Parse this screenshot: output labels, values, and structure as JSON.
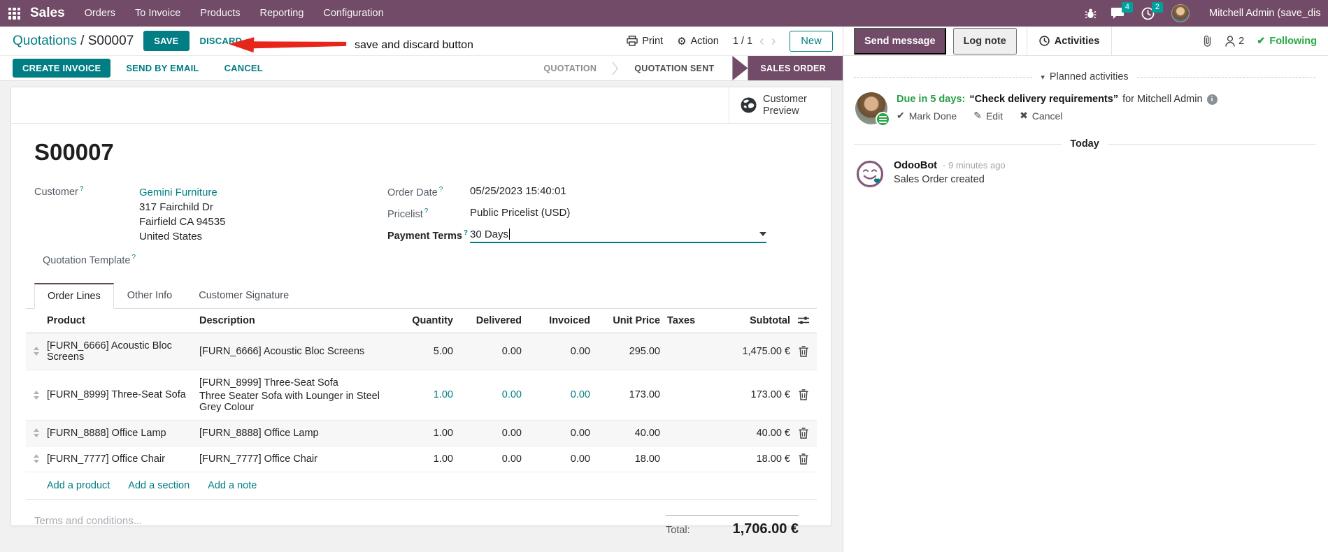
{
  "topbar": {
    "app_name": "Sales",
    "menus": [
      "Orders",
      "To Invoice",
      "Products",
      "Reporting",
      "Configuration"
    ],
    "message_badge": "4",
    "activity_badge": "2",
    "user_name": "Mitchell Admin (save_discar"
  },
  "control_panel": {
    "breadcrumb_parent": "Quotations",
    "breadcrumb_sep": " / ",
    "breadcrumb_current": "S00007",
    "save_label": "SAVE",
    "discard_label": "DISCARD",
    "annotation": "save and discard button",
    "print_label": "Print",
    "action_label": "Action",
    "pager": "1 / 1",
    "new_label": "New"
  },
  "statusbar": {
    "buttons": [
      "CREATE INVOICE",
      "SEND BY EMAIL",
      "CANCEL"
    ],
    "states": [
      "QUOTATION",
      "QUOTATION SENT",
      "SALES ORDER"
    ],
    "active_state": "SALES ORDER"
  },
  "sheet": {
    "customer_preview": {
      "line1": "Customer",
      "line2": "Preview"
    },
    "order_ref": "S00007",
    "fields": {
      "customer_label": "Customer",
      "customer_name": "Gemini Furniture",
      "address_line1": "317 Fairchild Dr",
      "address_line2": "Fairfield CA 94535",
      "address_line3": "United States",
      "quotation_template_label": "Quotation Template",
      "order_date_label": "Order Date",
      "order_date_value": "05/25/2023 15:40:01",
      "pricelist_label": "Pricelist",
      "pricelist_value": "Public Pricelist (USD)",
      "payment_terms_label": "Payment Terms",
      "payment_terms_value": "30 Days"
    },
    "tabs": [
      "Order Lines",
      "Other Info",
      "Customer Signature"
    ],
    "active_tab": "Order Lines",
    "order_lines": {
      "columns": [
        "Product",
        "Description",
        "Quantity",
        "Delivered",
        "Invoiced",
        "Unit Price",
        "Taxes",
        "Subtotal"
      ],
      "rows": [
        {
          "product": "[FURN_6666] Acoustic Bloc Screens",
          "description": "[FURN_6666] Acoustic Bloc Screens",
          "description2": "",
          "quantity": "5.00",
          "delivered": "0.00",
          "invoiced": "0.00",
          "unit_price": "295.00",
          "taxes": "",
          "subtotal": "1,475.00 €",
          "highlight": false
        },
        {
          "product": "[FURN_8999] Three-Seat Sofa",
          "description": "[FURN_8999] Three-Seat Sofa",
          "description2": "Three Seater Sofa with Lounger in Steel Grey Colour",
          "quantity": "1.00",
          "delivered": "0.00",
          "invoiced": "0.00",
          "unit_price": "173.00",
          "taxes": "",
          "subtotal": "173.00 €",
          "highlight": true
        },
        {
          "product": "[FURN_8888] Office Lamp",
          "description": "[FURN_8888] Office Lamp",
          "description2": "",
          "quantity": "1.00",
          "delivered": "0.00",
          "invoiced": "0.00",
          "unit_price": "40.00",
          "taxes": "",
          "subtotal": "40.00 €",
          "highlight": false
        },
        {
          "product": "[FURN_7777] Office Chair",
          "description": "[FURN_7777] Office Chair",
          "description2": "",
          "quantity": "1.00",
          "delivered": "0.00",
          "invoiced": "0.00",
          "unit_price": "18.00",
          "taxes": "",
          "subtotal": "18.00 €",
          "highlight": false
        }
      ],
      "footer_links": [
        "Add a product",
        "Add a section",
        "Add a note"
      ]
    },
    "terms_placeholder": "Terms and conditions...",
    "total_label": "Total:",
    "total_value": "1,706.00 €"
  },
  "chatter": {
    "send_message_label": "Send message",
    "log_note_label": "Log note",
    "activities_label": "Activities",
    "followers_count": "2",
    "following_label": "Following",
    "planned_activities_header": "Planned activities",
    "activity": {
      "due": "Due in 5 days:",
      "summary": "“Check delivery requirements”",
      "assignee": "for Mitchell Admin",
      "mark_done_label": "Mark Done",
      "edit_label": "Edit",
      "cancel_label": "Cancel"
    },
    "today_header": "Today",
    "message": {
      "author": "OdooBot",
      "time": "- 9 minutes ago",
      "body": "Sales Order created"
    }
  },
  "icons": {
    "gear": "⚙",
    "check": "✔",
    "pencil": "✎",
    "cross": "✖",
    "caret_down": "▾",
    "prev": "‹",
    "next": "›",
    "info": "i",
    "question": "?"
  },
  "colors": {
    "brand_purple": "#714B67",
    "accent_teal": "#017E84",
    "badge_teal": "#00A09D",
    "success_green": "#28a745",
    "annotation_red": "#E8251B"
  }
}
